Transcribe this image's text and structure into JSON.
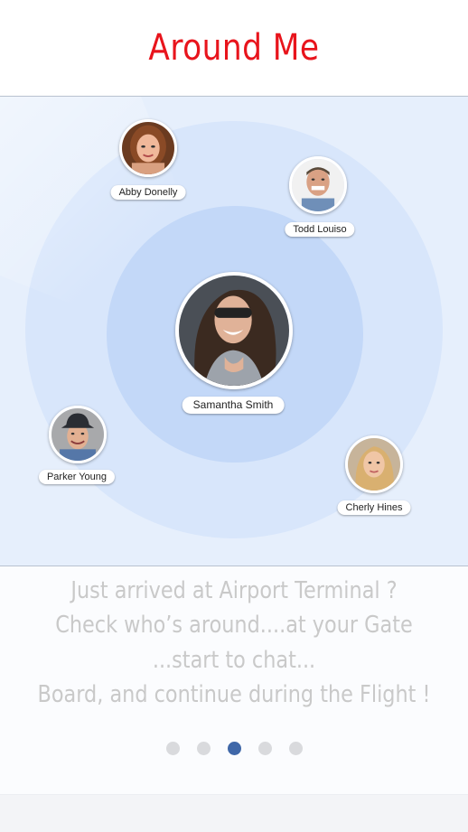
{
  "header": {
    "title": "Around Me"
  },
  "people": [
    {
      "name": "Abby Donelly",
      "avatar": "avatar-abby-donelly"
    },
    {
      "name": "Todd Louiso",
      "avatar": "avatar-todd-louiso"
    },
    {
      "name": "Samantha Smith",
      "avatar": "avatar-samantha-smith"
    },
    {
      "name": "Parker Young",
      "avatar": "avatar-parker-young"
    },
    {
      "name": "Cherly Hines",
      "avatar": "avatar-cherly-hines"
    }
  ],
  "caption": {
    "lines": [
      "Just arrived at Airport Terminal ?",
      "Check who’s around....at your Gate",
      "...start to chat...",
      "Board, and continue during the Flight !"
    ]
  },
  "pager": {
    "count": 5,
    "active_index": 2
  },
  "colors": {
    "title": "#e8141c",
    "radar_bg": "#e6effc",
    "ring_outer": "#d8e6fb",
    "ring_inner": "#c3d8f8",
    "caption_text": "#c9c9c9",
    "dot_active": "#3f67a8",
    "dot_inactive": "#d9dadd"
  }
}
